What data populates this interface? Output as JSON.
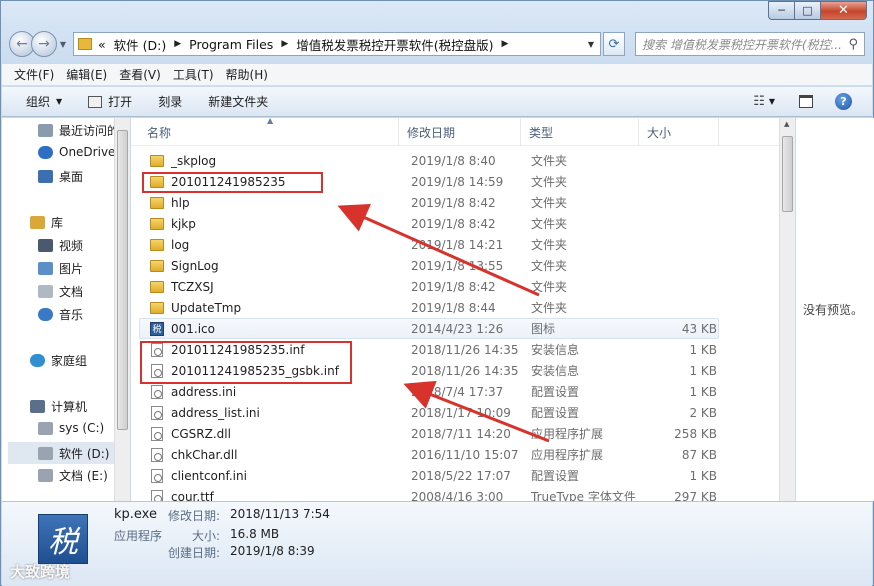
{
  "window": {
    "caption": {
      "minimize": "─",
      "maximize": "□",
      "close": "✕"
    }
  },
  "nav": {
    "back_icon": "←",
    "forward_icon": "→",
    "dropdown_icon": "▼",
    "address": {
      "prefix": "«",
      "crumbs": [
        "软件 (D:)",
        "Program Files",
        "增值税发票税控开票软件(税控盘版)"
      ],
      "sep": "▶",
      "dropdown": "▼"
    },
    "refresh_icon": "⟳",
    "search": {
      "placeholder": "搜索 增值税发票税控开票软件(税控...",
      "icon": "⚲"
    }
  },
  "menu": [
    "文件(F)",
    "编辑(E)",
    "查看(V)",
    "工具(T)",
    "帮助(H)"
  ],
  "toolbar": {
    "organize": "组织",
    "open": "打开",
    "burn": "刻录",
    "new_folder": "新建文件夹",
    "caret": "▼",
    "views_icon": "☷",
    "help": "?"
  },
  "sidebar": {
    "items": [
      {
        "label": "最近访问的",
        "icon": "recent-icon",
        "color": "#8a9bb0"
      },
      {
        "label": "OneDrive",
        "icon": "cloud-icon",
        "color": "#2d6fc4"
      },
      {
        "label": "桌面",
        "icon": "desktop-icon",
        "color": "#3b6fb0"
      },
      {
        "label": "库",
        "icon": "library-icon",
        "color": "#d9a83a"
      },
      {
        "label": "视频",
        "icon": "video-icon",
        "color": "#4a5a6e"
      },
      {
        "label": "图片",
        "icon": "pictures-icon",
        "color": "#5c8fc8"
      },
      {
        "label": "文档",
        "icon": "documents-icon",
        "color": "#b0b8c4"
      },
      {
        "label": "音乐",
        "icon": "music-icon",
        "color": "#3b78c8"
      },
      {
        "label": "家庭组",
        "icon": "homegroup-icon",
        "color": "#2f8fd0"
      },
      {
        "label": "计算机",
        "icon": "computer-icon",
        "color": "#5a6f8a"
      },
      {
        "label": "sys (C:)",
        "icon": "drive-icon",
        "color": "#9aa4b0"
      },
      {
        "label": "软件 (D:)",
        "icon": "drive-icon",
        "color": "#9aa4b0"
      },
      {
        "label": "文档 (E:)",
        "icon": "drive-icon",
        "color": "#9aa4b0"
      }
    ]
  },
  "columns": {
    "name": "名称",
    "date": "修改日期",
    "type": "类型",
    "size": "大小",
    "sort": "▲"
  },
  "files": [
    {
      "name": "_skplog",
      "date": "2019/1/8 8:40",
      "type": "文件夹",
      "size": "",
      "icon": "folder-icon"
    },
    {
      "name": "201011241985235",
      "date": "2019/1/8 14:59",
      "type": "文件夹",
      "size": "",
      "icon": "folder-icon"
    },
    {
      "name": "hlp",
      "date": "2019/1/8 8:42",
      "type": "文件夹",
      "size": "",
      "icon": "folder-icon"
    },
    {
      "name": "kjkp",
      "date": "2019/1/8 8:42",
      "type": "文件夹",
      "size": "",
      "icon": "folder-icon"
    },
    {
      "name": "log",
      "date": "2019/1/8 14:21",
      "type": "文件夹",
      "size": "",
      "icon": "folder-icon"
    },
    {
      "name": "SignLog",
      "date": "2019/1/8 13:55",
      "type": "文件夹",
      "size": "",
      "icon": "folder-icon"
    },
    {
      "name": "TCZXSJ",
      "date": "2019/1/8 8:42",
      "type": "文件夹",
      "size": "",
      "icon": "folder-icon"
    },
    {
      "name": "UpdateTmp",
      "date": "2019/1/8 8:44",
      "type": "文件夹",
      "size": "",
      "icon": "folder-icon"
    },
    {
      "name": "001.ico",
      "date": "2014/4/23 1:26",
      "type": "图标",
      "size": "43 KB",
      "icon": "ico-file-icon"
    },
    {
      "name": "201011241985235.inf",
      "date": "2018/11/26 14:35",
      "type": "安装信息",
      "size": "1 KB",
      "icon": "inf-file-icon"
    },
    {
      "name": "201011241985235_gsbk.inf",
      "date": "2018/11/26 14:35",
      "type": "安装信息",
      "size": "1 KB",
      "icon": "inf-file-icon"
    },
    {
      "name": "address.ini",
      "date": "2018/7/4 17:37",
      "type": "配置设置",
      "size": "1 KB",
      "icon": "ini-file-icon"
    },
    {
      "name": "address_list.ini",
      "date": "2018/1/17 10:09",
      "type": "配置设置",
      "size": "2 KB",
      "icon": "ini-file-icon"
    },
    {
      "name": "CGSRZ.dll",
      "date": "2018/7/11 14:20",
      "type": "应用程序扩展",
      "size": "258 KB",
      "icon": "dll-file-icon"
    },
    {
      "name": "chkChar.dll",
      "date": "2016/11/10 15:07",
      "type": "应用程序扩展",
      "size": "87 KB",
      "icon": "dll-file-icon"
    },
    {
      "name": "clientconf.ini",
      "date": "2018/5/22 17:07",
      "type": "配置设置",
      "size": "1 KB",
      "icon": "ini-file-icon"
    },
    {
      "name": "cour.ttf",
      "date": "2008/4/16 3:00",
      "type": "TrueType 字体文件",
      "size": "297 KB",
      "icon": "font-file-icon"
    }
  ],
  "preview": {
    "empty": "没有预览。"
  },
  "details": {
    "icon_glyph": "税",
    "filename": "kp.exe",
    "type": "应用程序",
    "modified_label": "修改日期:",
    "modified": "2018/11/13 7:54",
    "size_label": "大小:",
    "size": "16.8 MB",
    "created_label": "创建日期:",
    "created": "2019/1/8 8:39"
  },
  "watermark": "大致跨境",
  "colors": {
    "annotation": "#d8322c",
    "folder": "#e0ad2c",
    "selection": "#ecf2f9"
  }
}
